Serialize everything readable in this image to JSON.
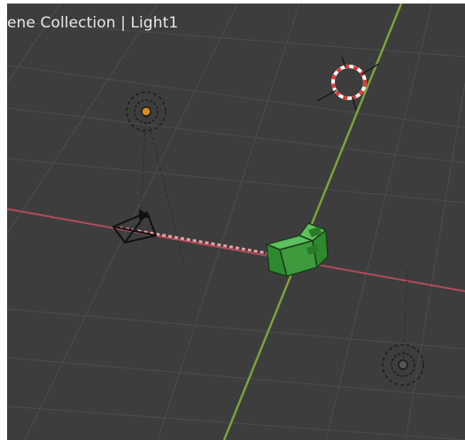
{
  "viewport": {
    "scene_label": "ene Collection | Light1",
    "colors": {
      "background": "#3d3d3d",
      "grid": "#4a4a4a",
      "x_axis": "#b24b5a",
      "y_axis": "#7da23a",
      "selected_object": "#3d9a3d",
      "light_active": "#e08a1e",
      "camera": "#111111"
    },
    "objects": {
      "camera": {
        "name": "camera-icon"
      },
      "light_selected": {
        "name": "light-selected-icon"
      },
      "light_secondary": {
        "name": "light-icon"
      },
      "sun_target": {
        "name": "target-icon"
      },
      "mesh": {
        "name": "cube-mesh"
      }
    }
  }
}
